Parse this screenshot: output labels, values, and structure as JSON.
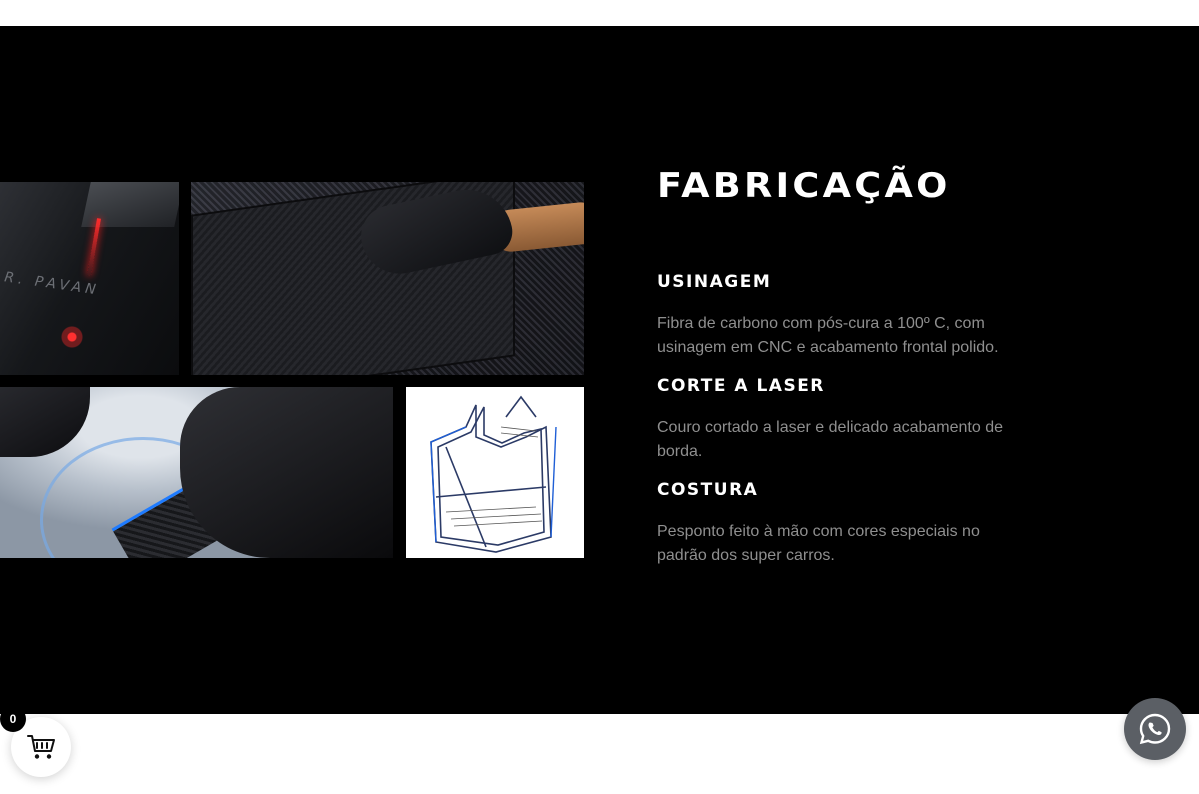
{
  "section": {
    "title": "FABRICAÇÃO",
    "items": [
      {
        "heading": "USINAGEM",
        "text": "Fibra de carbono com pós-cura a 100º C, com usinagem em CNC e acabamento frontal polido."
      },
      {
        "heading": "CORTE A LASER",
        "text": "Couro cortado a laser e delicado acabamento de borda."
      },
      {
        "heading": "COSTURA",
        "text": "Pesponto feito à mão com cores especiais no padrão dos super carros."
      }
    ]
  },
  "images": [
    {
      "icon": "laser-engraving-photo",
      "engraving": "R. PAVAN"
    },
    {
      "icon": "carbon-fiber-cnc-photo"
    },
    {
      "icon": "hand-stitching-photo"
    },
    {
      "icon": "wallet-sketch-drawing"
    }
  ],
  "cart": {
    "count": "0",
    "icon": "shopping-cart-icon"
  },
  "whatsapp": {
    "icon": "whatsapp-icon"
  },
  "colors": {
    "section_bg": "#000000",
    "heading": "#ffffff",
    "body_text": "#8f8f8f",
    "whatsapp_bg": "#5b5f65"
  }
}
